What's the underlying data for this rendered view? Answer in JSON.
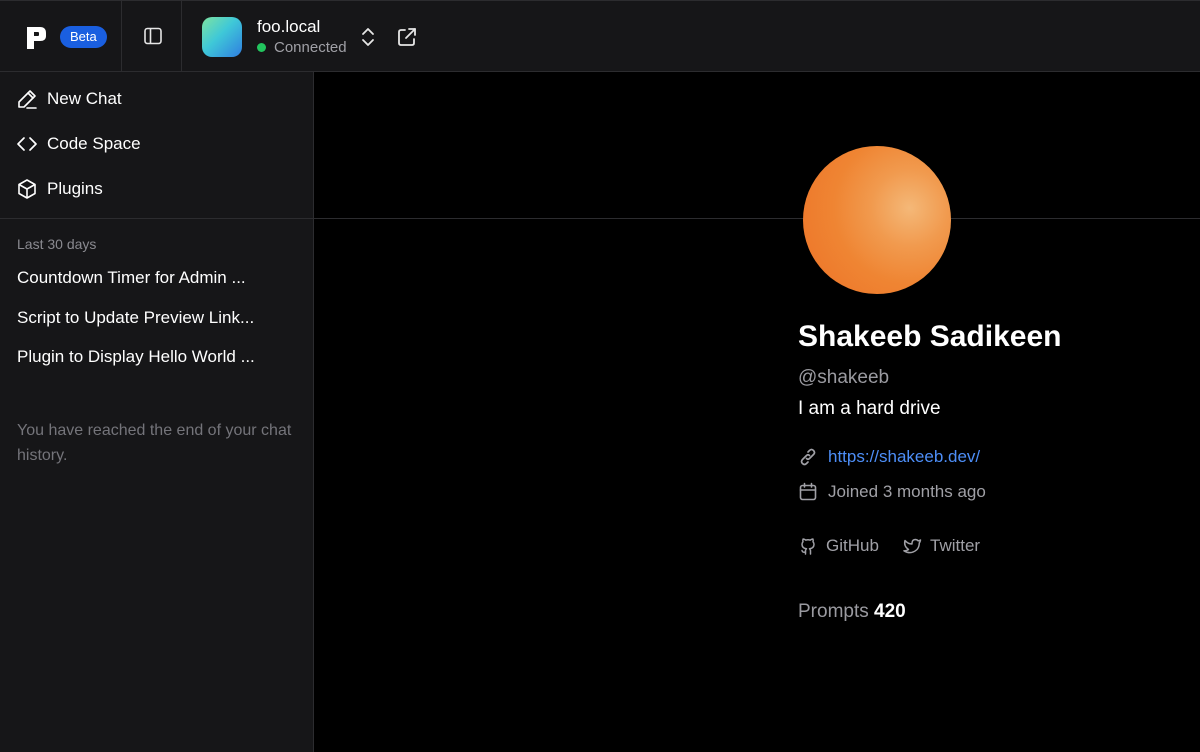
{
  "header": {
    "beta_label": "Beta",
    "host_name": "foo.local",
    "status": "Connected",
    "status_color": "#22c55e"
  },
  "sidebar": {
    "nav": [
      {
        "label": "New Chat",
        "icon": "pencil-icon"
      },
      {
        "label": "Code Space",
        "icon": "code-icon"
      },
      {
        "label": "Plugins",
        "icon": "cube-icon"
      }
    ],
    "section_label": "Last 30 days",
    "history": [
      "Countdown Timer for Admin ...",
      "Script to Update Preview Link...",
      "Plugin to Display Hello World ..."
    ],
    "end_note": "You have reached the end of your chat history."
  },
  "profile": {
    "name": "Shakeeb Sadikeen",
    "handle": "@shakeeb",
    "bio": "I am a hard drive",
    "website": "https://shakeeb.dev/",
    "joined": "Joined 3 months ago",
    "socials": [
      {
        "label": "GitHub",
        "icon": "github-icon"
      },
      {
        "label": "Twitter",
        "icon": "twitter-icon"
      }
    ],
    "prompts_label": "Prompts",
    "prompts_count": "420"
  },
  "colors": {
    "accent": "#1a5fe0",
    "link": "#4d8ef7",
    "avatar": "#ef8533"
  }
}
